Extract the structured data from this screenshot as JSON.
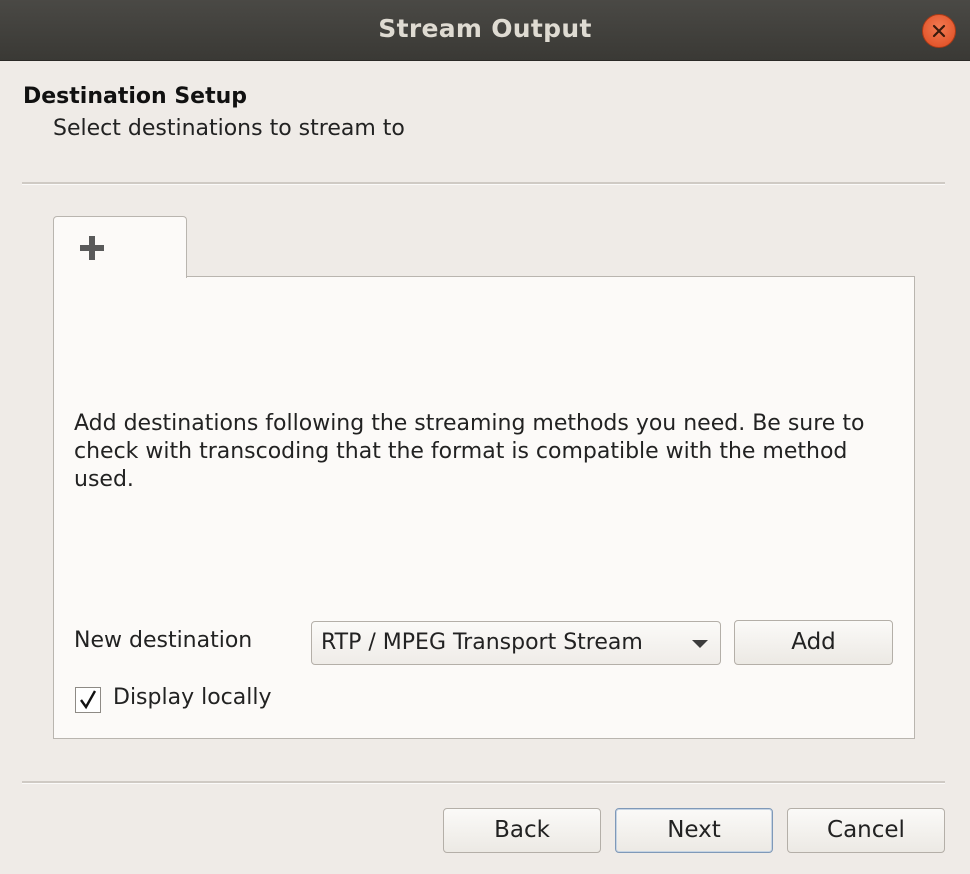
{
  "window": {
    "title": "Stream Output",
    "close_icon": "close-icon"
  },
  "header": {
    "title": "Destination Setup",
    "subtitle": "Select destinations to stream to"
  },
  "tabs": [
    {
      "icon": "plus-icon",
      "active": true
    }
  ],
  "panel": {
    "info_text": "Add destinations following the streaming methods you need. Be sure to check with transcoding that the format is compatible with the method used.",
    "new_destination_label": "New destination",
    "destination_select": {
      "selected": "RTP / MPEG Transport Stream"
    },
    "add_button_label": "Add",
    "display_locally": {
      "label": "Display locally",
      "checked": true
    }
  },
  "footer": {
    "back_label": "Back",
    "next_label": "Next",
    "cancel_label": "Cancel"
  },
  "colors": {
    "background": "#efebe7",
    "titlebar": "#3f3e3a",
    "close_button": "#e8582b",
    "panel": "#fcfaf8",
    "default_button_border": "#7f99b8"
  }
}
